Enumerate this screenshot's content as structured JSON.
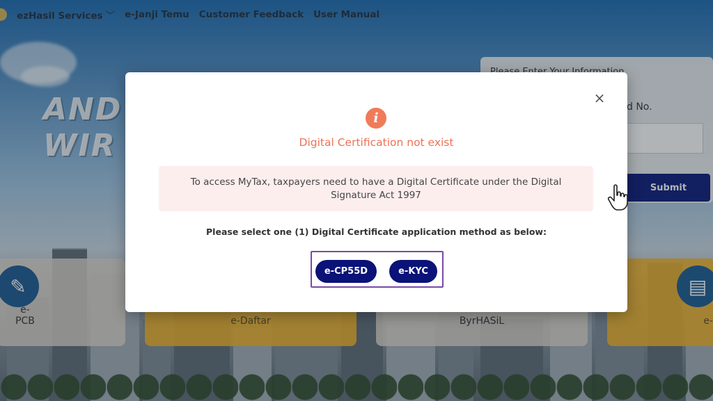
{
  "nav": {
    "items": [
      "ezHasil Services",
      "e-Janji Temu",
      "Customer Feedback",
      "User Manual"
    ],
    "dropdown_glyph": "﹀"
  },
  "hero": {
    "line1": "AND",
    "line2": "WIR"
  },
  "form": {
    "hint": "Please Enter Your Information",
    "id_label": "d No.",
    "submit_label": "Submit"
  },
  "tiles": [
    {
      "label": "e-PCB"
    },
    {
      "label": "e-Daftar"
    },
    {
      "label": "ByrHASiL"
    },
    {
      "label": "e-"
    }
  ],
  "modal": {
    "close_glyph": "×",
    "info_glyph": "i",
    "title": "Digital Certification not exist",
    "message": "To access MyTax, taxpayers need to have a Digital Certificate under the Digital Signature Act 1997",
    "instruction": "Please select one (1) Digital Certificate application method as below:",
    "options": [
      "e-CP55D",
      "e-KYC"
    ]
  },
  "colors": {
    "title": "#ee7155",
    "info_icon": "#f07b5a",
    "alert_bg": "#fdeeee",
    "pill": "#0b1278",
    "highlight_border": "#7a4aa8"
  },
  "icons": {
    "close": "close-icon",
    "info": "info-icon",
    "cursor": "hand-pointer-icon"
  }
}
